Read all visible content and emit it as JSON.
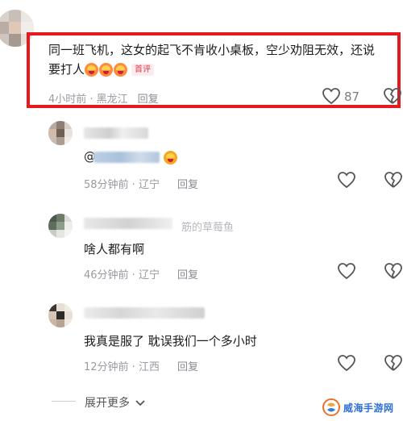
{
  "comments": [
    {
      "text_line1": "同一班飞机，这女的起飞不肯收小桌板，空少劝阻无效，还说",
      "text_line2": "要打人",
      "tag": "首评",
      "time": "4小时前 · 黑龙江",
      "reply": "回复",
      "likes": "87"
    },
    {
      "mention": "@",
      "time": "58分钟前 · 辽宁",
      "reply": "回复"
    },
    {
      "name_fragment": "筋的草莓鱼",
      "text": "啥人都有啊",
      "time": "46分钟前 · 辽宁",
      "reply": "回复"
    },
    {
      "text": "我真是服了 耽误我们一个多小时",
      "time": "12分钟前 · 江西",
      "reply": "回复"
    }
  ],
  "expand_label": "展开更多",
  "watermark": "威海手游网",
  "icons": {
    "like": "heart-outline-icon",
    "dislike": "broken-heart-icon",
    "expand": "chevron-down-icon",
    "emoji": "laughing-emoji-icon"
  },
  "colors": {
    "highlight": "#e5191e",
    "tag_text": "#e5394c",
    "watermark": "#2e6fd8"
  }
}
